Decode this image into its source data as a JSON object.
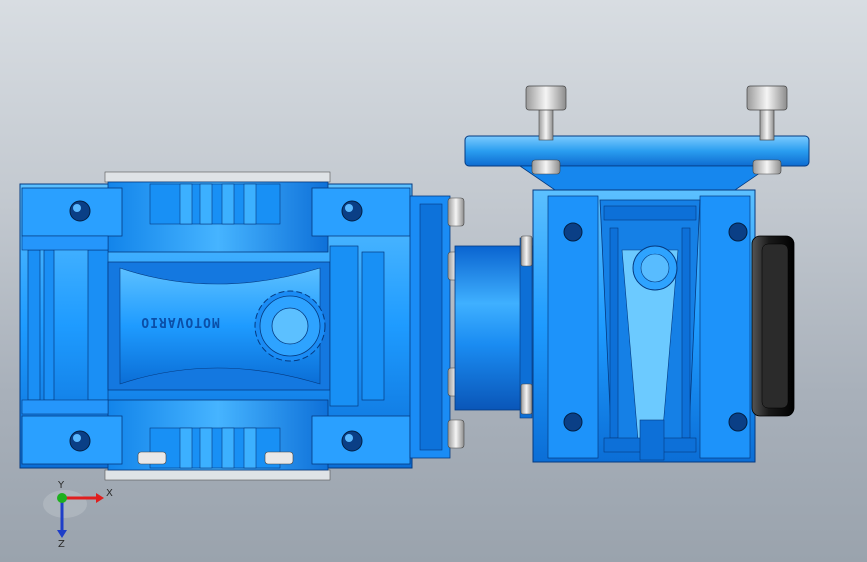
{
  "viewport": {
    "background_top": "#d8dde2",
    "background_bottom": "#9aa3ad"
  },
  "model": {
    "engraving": "MOTOVARIO",
    "body_color": "#1e9bff",
    "body_dark": "#0a5fbf",
    "flange_color": "#2a9df0",
    "seal_color": "#1a1a1a",
    "bolt_color": "#e8e8e8"
  },
  "triad": {
    "x_label": "X",
    "y_label": "Y",
    "z_label": "Z",
    "x_color": "#e01e1e",
    "y_color": "#1eb01e",
    "z_color": "#1e3ec8"
  }
}
